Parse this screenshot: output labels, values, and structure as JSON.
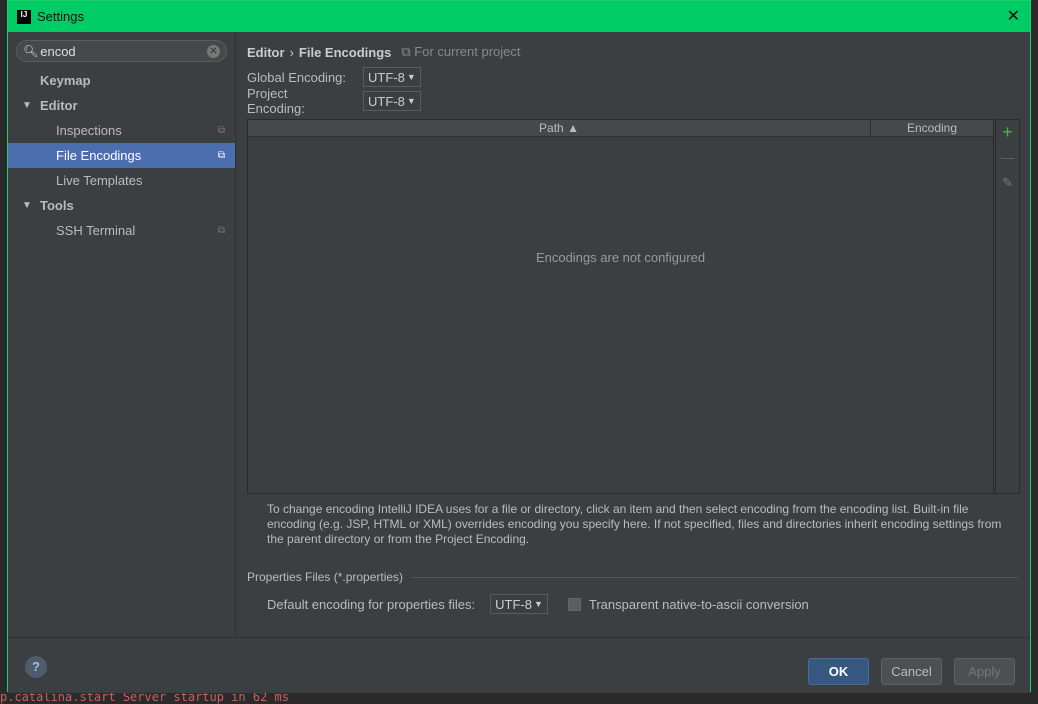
{
  "window": {
    "title": "Settings",
    "logo": "IJ"
  },
  "search": {
    "value": "encod"
  },
  "sidebar": {
    "items": [
      {
        "label": "Keymap"
      },
      {
        "label": "Editor"
      },
      {
        "label": "Inspections"
      },
      {
        "label": "File Encodings"
      },
      {
        "label": "Live Templates"
      },
      {
        "label": "Tools"
      },
      {
        "label": "SSH Terminal"
      }
    ]
  },
  "breadcrumb": {
    "parent": "Editor",
    "sep": "›",
    "current": "File Encodings",
    "scope": "For current project"
  },
  "global_encoding": {
    "label": "Global Encoding:",
    "value": "UTF-8"
  },
  "project_encoding": {
    "label": "Project Encoding:",
    "value": "UTF-8"
  },
  "table": {
    "col_path": "Path ▲",
    "col_encoding": "Encoding",
    "empty": "Encodings are not configured"
  },
  "description": "To change encoding IntelliJ IDEA uses for a file or directory, click an item and then select encoding from the encoding list. Built-in file encoding (e.g. JSP, HTML or XML) overrides encoding you specify here. If not specified, files and directories inherit encoding settings from the parent directory or from the Project Encoding.",
  "properties": {
    "group": "Properties Files (*.properties)",
    "label": "Default encoding for properties files:",
    "value": "UTF-8",
    "checkbox": "Transparent native-to-ascii conversion",
    "checked": false
  },
  "buttons": {
    "ok": "OK",
    "cancel": "Cancel",
    "apply": "Apply",
    "help": "?"
  },
  "background_log": "p.catalina.start Server startup in 62 ms"
}
